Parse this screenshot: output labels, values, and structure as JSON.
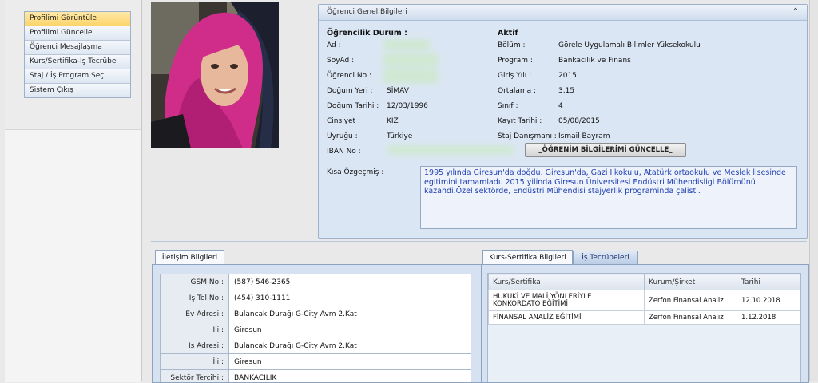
{
  "menu": [
    {
      "label": "Profilimi Görüntüle",
      "active": true
    },
    {
      "label": "Profilimi Güncelle",
      "active": false
    },
    {
      "label": "Öğrenci Mesajlaşma",
      "active": false
    },
    {
      "label": "Kurs/Sertifika-İş Tecrübe",
      "active": false
    },
    {
      "label": "Staj / İş Program Seç",
      "active": false
    },
    {
      "label": "Sistem Çıkış",
      "active": false
    }
  ],
  "general": {
    "title": "Öğrenci Genel Bilgileri",
    "collapse_icon": "chevron-up-icon",
    "status_label": "Öğrencilik Durum :",
    "status_value": "Aktif",
    "left": {
      "ad_label": "Ad :",
      "soyad_label": "SoyAd :",
      "ogrno_label": "Öğrenci No :",
      "dogum_yeri_label": "Doğum Yeri :",
      "dogum_yeri": "SİMAV",
      "dogum_tarihi_label": "Doğum Tarihi :",
      "dogum_tarihi": "12/03/1996",
      "cinsiyet_label": "Cinsiyet :",
      "cinsiyet": "KIZ",
      "uyrugu_label": "Uyruğu :",
      "uyrugu": "Türkiye",
      "iban_label": "IBAN No :"
    },
    "right": {
      "bolum_label": "Bölüm :",
      "bolum": "Görele Uygulamalı Bilimler Yüksekokulu",
      "program_label": "Program :",
      "program": "Bankacılık ve Finans",
      "giris_label": "Giriş Yılı :",
      "giris": "2015",
      "ortalama_label": "Ortalama :",
      "ortalama": "3,15",
      "sinif_label": "Sınıf :",
      "sinif": "4",
      "kayit_label": "Kayıt Tarihi :",
      "kayit": "05/08/2015",
      "danisman_label": "Staj Danışmanı :",
      "danisman": "İsmail Bayram"
    },
    "update_button": "_ÖĞRENİM BİLGİLERİMİ GÜNCELLE_",
    "bio_label": "Kısa Özgeçmiş :",
    "bio": "1995 yılında Giresun'da doğdu. Giresun'da,  Gazi Ilkokulu, Atatürk ortaokulu ve Meslek lisesinde egitimini  tamamladı. 2015 yilinda Giresun Üniversitesi Endüstri Mühendisligi Bölümünü kazandi.Özel sektörde, Endüstri Mühendisi stajyerlik programinda çalisti."
  },
  "contact": {
    "tab": "İletişim Bilgileri",
    "rows": [
      {
        "label": "GSM No :",
        "value": "(587) 546-2365"
      },
      {
        "label": "İş Tel.No :",
        "value": "(454) 310-1111"
      },
      {
        "label": "Ev Adresi :",
        "value": "Bulancak Durağı G-City Avm 2.Kat"
      },
      {
        "label": "İli :",
        "value": "Giresun"
      },
      {
        "label": "İş Adresi :",
        "value": "Bulancak Durağı G-City Avm 2.Kat"
      },
      {
        "label": "İli :",
        "value": "Giresun"
      },
      {
        "label": "Sektör Tercihi :",
        "value": "BANKACILIK"
      }
    ]
  },
  "kurs": {
    "tabs": [
      "Kurs-Sertifika Bilgileri",
      "İş Tecrübeleri"
    ],
    "headers": [
      "Kurs/Sertifika",
      "Kurum/Şirket",
      "Tarihi"
    ],
    "rows": [
      {
        "kurs": "HUKUKİ VE MALİ YÖNLERİYLE KONKORDATO EĞİTİMİ",
        "kurum": "Zerfon Finansal Analiz",
        "tarih": "12.10.2018"
      },
      {
        "kurs": "FİNANSAL ANALİZ EĞİTİMİ",
        "kurum": "Zerfon Finansal Analiz",
        "tarih": "1.12.2018"
      }
    ]
  }
}
